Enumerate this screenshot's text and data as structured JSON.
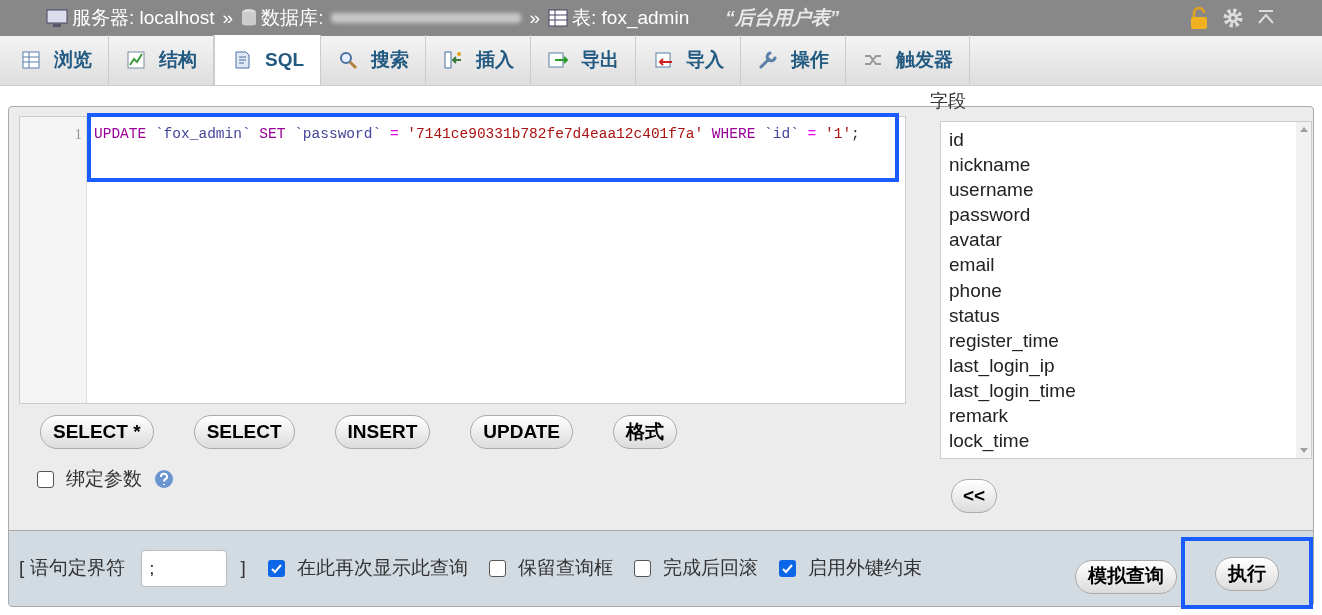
{
  "breadcrumb": {
    "server": "服务器: localhost",
    "separators": [
      "»",
      "»"
    ],
    "database": "数据库:",
    "table": "表: fox_admin",
    "comment": "“后台用户表”"
  },
  "tabs": [
    {
      "label": "浏览",
      "kind": "table",
      "selected": false
    },
    {
      "label": "结构",
      "kind": "structure",
      "selected": false
    },
    {
      "label": "SQL",
      "kind": "sql",
      "selected": true
    },
    {
      "label": "搜索",
      "kind": "search",
      "selected": false
    },
    {
      "label": "插入",
      "kind": "insert",
      "selected": false
    },
    {
      "label": "导出",
      "kind": "export",
      "selected": false
    },
    {
      "label": "导入",
      "kind": "import",
      "selected": false
    },
    {
      "label": "操作",
      "kind": "wrench",
      "selected": false
    },
    {
      "label": "触发器",
      "kind": "trigger",
      "selected": false
    }
  ],
  "editor": {
    "line_number": "1",
    "tokens": [
      {
        "text": "UPDATE ",
        "kind": "keyword"
      },
      {
        "text": "`fox_admin` ",
        "kind": "identifier"
      },
      {
        "text": "SET ",
        "kind": "keyword"
      },
      {
        "text": "`password` ",
        "kind": "identifier"
      },
      {
        "text": "= ",
        "kind": "operator"
      },
      {
        "text": "'7141ce90331b782fe7d4eaa12c401f7a' ",
        "kind": "string"
      },
      {
        "text": "WHERE ",
        "kind": "keyword"
      },
      {
        "text": "`id` ",
        "kind": "identifier"
      },
      {
        "text": "= ",
        "kind": "operator"
      },
      {
        "text": "'1'",
        "kind": "string"
      },
      {
        "text": ";",
        "kind": "plain"
      }
    ]
  },
  "query_buttons": [
    "SELECT *",
    "SELECT",
    "INSERT",
    "UPDATE",
    "格式"
  ],
  "bind_parameters": {
    "label": "绑定参数",
    "checked": false
  },
  "fields": {
    "title": "字段",
    "items": [
      "id",
      "nickname",
      "username",
      "password",
      "avatar",
      "email",
      "phone",
      "status",
      "register_time",
      "last_login_ip",
      "last_login_time",
      "remark",
      "lock_time"
    ],
    "insert_button": "<<"
  },
  "footer": {
    "delimiter_label_open": "[ 语句定界符",
    "delimiter_value": ";",
    "delimiter_label_close": "]",
    "options": [
      {
        "label": "在此再次显示此查询",
        "checked": true
      },
      {
        "label": "保留查询框",
        "checked": false
      },
      {
        "label": "完成后回滚",
        "checked": false
      },
      {
        "label": "启用外键约束",
        "checked": true
      }
    ],
    "simulate_button": "模拟查询",
    "execute_button": "执行"
  }
}
